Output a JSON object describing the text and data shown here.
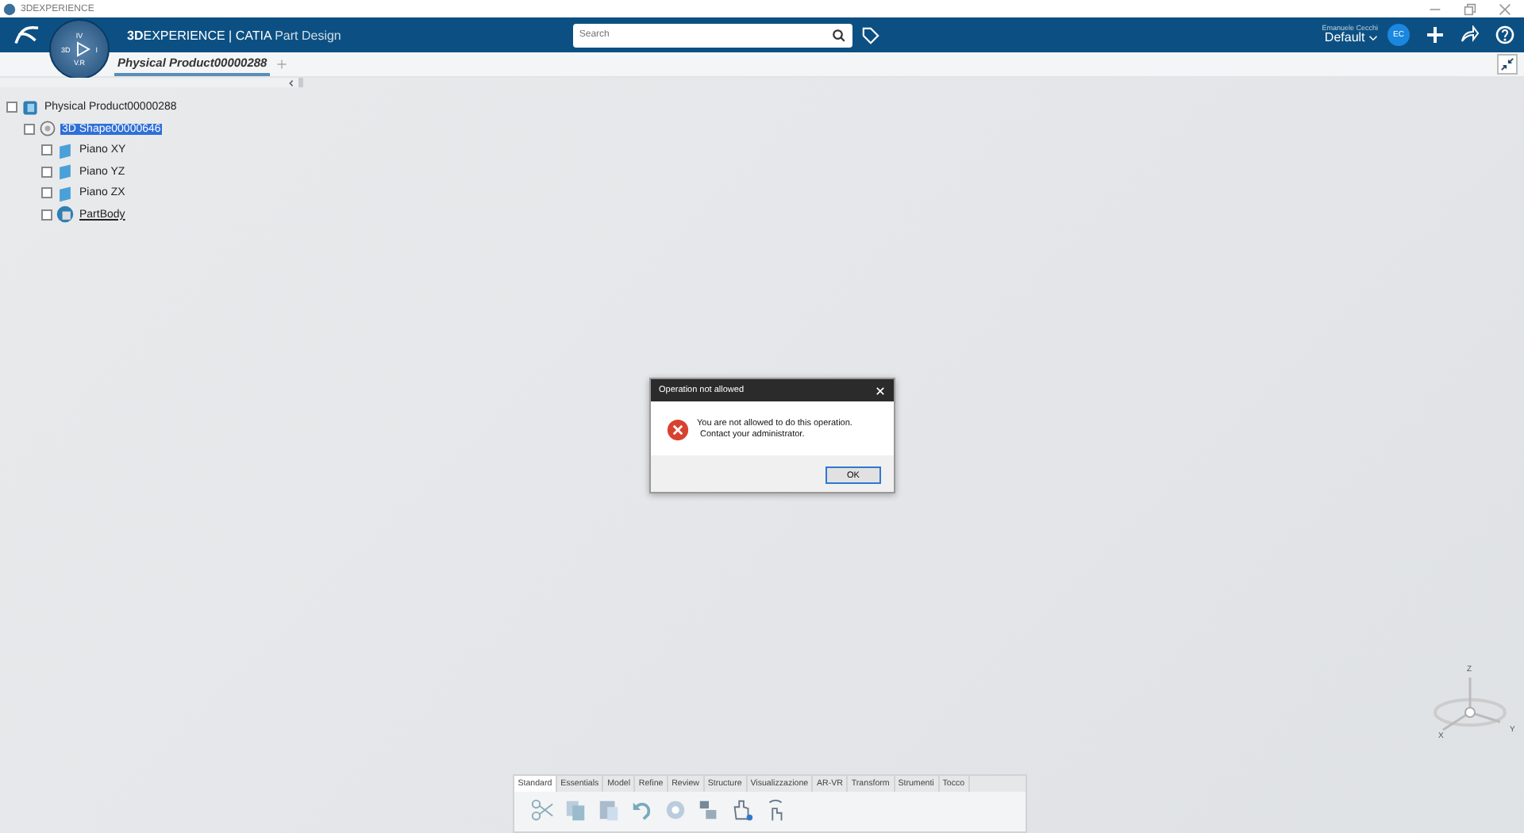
{
  "window": {
    "title": "3DEXPERIENCE"
  },
  "app_bar": {
    "brand_bold": "3D",
    "brand_rest": "EXPERIENCE | CATIA",
    "app": "Part Design",
    "compass": {
      "left": "3D",
      "right": "I",
      "top": "IV",
      "bottom": "V.R"
    },
    "user": "Emanuele Cecchi",
    "collab_space": "Default",
    "avatar": "EC",
    "search": {
      "placeholder": "Search"
    }
  },
  "tabs": [
    {
      "label": "Physical Product00000288",
      "selected": true
    }
  ],
  "tree": [
    {
      "label": "Physical Product00000288",
      "kind": "product",
      "selected": false,
      "in_work": false,
      "children": [
        {
          "label": "3D Shape00000646",
          "kind": "shape",
          "selected": true,
          "in_work": false,
          "children": [
            {
              "label": "Piano XY",
              "kind": "plane",
              "selected": false,
              "in_work": false
            },
            {
              "label": "Piano YZ",
              "kind": "plane",
              "selected": false,
              "in_work": false
            },
            {
              "label": "Piano ZX",
              "kind": "plane",
              "selected": false,
              "in_work": false
            },
            {
              "label": "PartBody",
              "kind": "body",
              "selected": false,
              "in_work": true
            }
          ]
        }
      ]
    }
  ],
  "dialog": {
    "title": "Operation not allowed",
    "message": [
      "You are not allowed to do this operation.",
      "Contact your administrator."
    ],
    "button": "OK"
  },
  "compass": {
    "z": "Z",
    "x": "X",
    "y": "Y"
  },
  "action_bar": {
    "tabs": [
      {
        "label": "Standard",
        "selected": true
      },
      {
        "label": "Essentials",
        "selected": false
      },
      {
        "label": "Model",
        "selected": false
      },
      {
        "label": "Refine",
        "selected": false
      },
      {
        "label": "Review",
        "selected": false
      },
      {
        "label": "Structure",
        "selected": false
      },
      {
        "label": "Visualizzazione",
        "selected": false
      },
      {
        "label": "AR-VR",
        "selected": false
      },
      {
        "label": "Transform",
        "selected": false
      },
      {
        "label": "Strumenti",
        "selected": false
      },
      {
        "label": "Tocco",
        "selected": false
      }
    ]
  }
}
